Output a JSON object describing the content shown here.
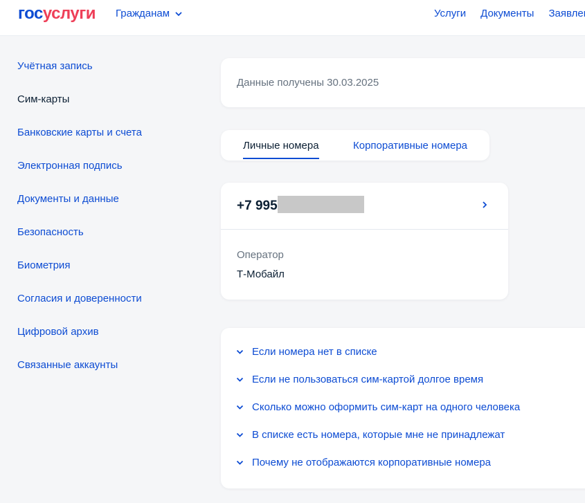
{
  "header": {
    "logo": {
      "gos": "гос",
      "uslugi": "услуги"
    },
    "audience": "Гражданам",
    "nav": [
      "Услуги",
      "Документы",
      "Заявления"
    ]
  },
  "sidebar": {
    "items": [
      {
        "label": "Учётная запись",
        "active": false
      },
      {
        "label": "Сим-карты",
        "active": true
      },
      {
        "label": "Банковские карты и счета",
        "active": false
      },
      {
        "label": "Электронная подпись",
        "active": false
      },
      {
        "label": "Документы и данные",
        "active": false
      },
      {
        "label": "Безопасность",
        "active": false
      },
      {
        "label": "Биометрия",
        "active": false
      },
      {
        "label": "Согласия и доверенности",
        "active": false
      },
      {
        "label": "Цифровой архив",
        "active": false
      },
      {
        "label": "Связанные аккаунты",
        "active": false
      }
    ]
  },
  "received": "Данные получены 30.03.2025",
  "tabs": {
    "personal": "Личные номера",
    "corporate": "Корпоративные номера"
  },
  "phone": {
    "number_prefix": "+7 995",
    "operator_label": "Оператор",
    "operator_value": "Т-Мобайл"
  },
  "faq": [
    "Если номера нет в списке",
    "Если не пользоваться сим-картой долгое время",
    "Сколько можно оформить сим-карт на одного человека",
    "В списке есть номера, которые мне не принадлежат",
    "Почему не отображаются корпоративные номера"
  ],
  "colors": {
    "accent": "#0d4cd3",
    "brand_red": "#ee3f58",
    "text": "#0b1f33",
    "muted": "#66727f"
  },
  "icons": {
    "dropdown": "chevron-down-icon",
    "open_phone": "chevron-right-icon",
    "faq_expand": "chevron-down-icon"
  }
}
